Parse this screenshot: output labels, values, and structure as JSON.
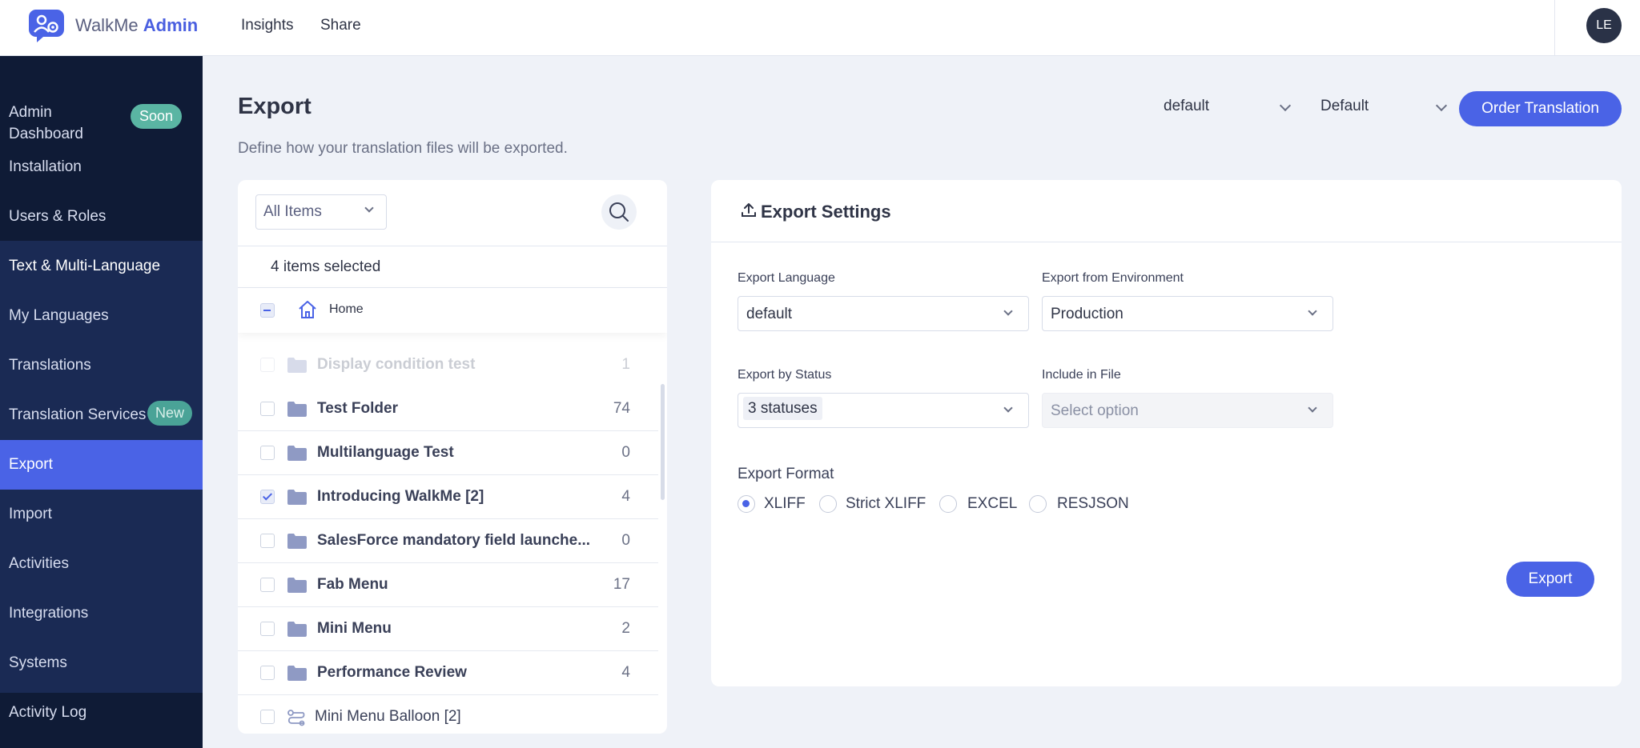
{
  "topbar": {
    "app_name_a": "WalkMe",
    "app_name_b": "Admin",
    "nav": [
      "Insights",
      "Share"
    ],
    "avatar": "LE"
  },
  "sidebar": {
    "items": [
      {
        "label": "Admin Dashboard",
        "badge": "Soon"
      },
      {
        "label": "Installation"
      },
      {
        "label": "Users & Roles"
      },
      {
        "label": "Text & Multi-Language"
      },
      {
        "label": "My Languages"
      },
      {
        "label": "Translations"
      },
      {
        "label": "Translation Services",
        "badge": "New"
      },
      {
        "label": "Export",
        "active": true
      },
      {
        "label": "Import"
      },
      {
        "label": "Activities"
      },
      {
        "label": "Integrations"
      },
      {
        "label": "Systems"
      },
      {
        "label": "Activity Log"
      }
    ]
  },
  "header": {
    "title": "Export",
    "description": "Define how your translation files will be exported.",
    "select1": "default",
    "select2": "Default",
    "order_button": "Order Translation"
  },
  "left_panel": {
    "filter": "All Items",
    "selected_count": "4 items selected",
    "home_label": "Home",
    "rows": [
      {
        "label": "Display condition test",
        "count": "1",
        "faded": true,
        "type": "folder",
        "checked": false
      },
      {
        "label": "Test Folder",
        "count": "74",
        "type": "folder",
        "checked": false
      },
      {
        "label": "Multilanguage Test",
        "count": "0",
        "type": "folder",
        "checked": false
      },
      {
        "label": "Introducing WalkMe [2]",
        "count": "4",
        "type": "folder",
        "checked": true
      },
      {
        "label": "SalesForce mandatory field launche...",
        "count": "0",
        "type": "folder",
        "checked": false
      },
      {
        "label": "Fab Menu",
        "count": "17",
        "type": "folder",
        "checked": false
      },
      {
        "label": "Mini Menu",
        "count": "2",
        "type": "folder",
        "checked": false
      },
      {
        "label": "Performance Review",
        "count": "4",
        "type": "folder",
        "checked": false
      },
      {
        "label": "Mini Menu Balloon [2]",
        "count": "",
        "type": "item",
        "checked": false
      }
    ]
  },
  "settings": {
    "title": "Export Settings",
    "export_language_label": "Export Language",
    "export_language_value": "default",
    "environment_label": "Export from Environment",
    "environment_value": "Production",
    "status_label": "Export by Status",
    "status_value": "3 statuses",
    "include_label": "Include in File",
    "include_placeholder": "Select option",
    "format_label": "Export Format",
    "formats": [
      "XLIFF",
      "Strict XLIFF",
      "EXCEL",
      "RESJSON"
    ],
    "selected_format": "XLIFF",
    "export_button": "Export"
  },
  "colors": {
    "primary": "#4a63e6",
    "sidebar_bg": "#0f1b36",
    "sidebar_band": "#1a2a54",
    "soon_badge": "#5ab5a3",
    "new_badge": "#4aa397",
    "page_bg": "#eff2f8"
  }
}
